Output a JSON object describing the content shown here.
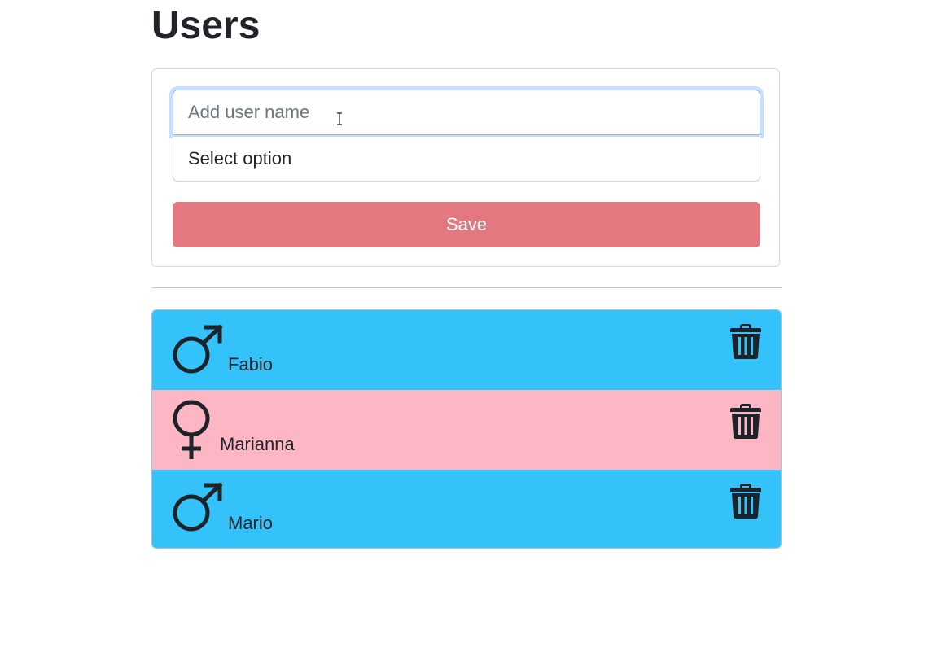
{
  "page": {
    "title": "Users"
  },
  "form": {
    "name_placeholder": "Add user name",
    "name_value": "",
    "select_value": "Select option",
    "save_label": "Save",
    "save_color": "#e37881"
  },
  "colors": {
    "male_row": "#33c3fa",
    "female_row": "#fcb6c4"
  },
  "users": [
    {
      "name": "Fabio",
      "gender_icon": "male-symbol-icon",
      "action_icon": "trash-icon"
    },
    {
      "name": "Marianna",
      "gender_icon": "female-symbol-icon",
      "action_icon": "trash-icon"
    },
    {
      "name": "Mario",
      "gender_icon": "male-symbol-icon",
      "action_icon": "trash-icon"
    }
  ]
}
